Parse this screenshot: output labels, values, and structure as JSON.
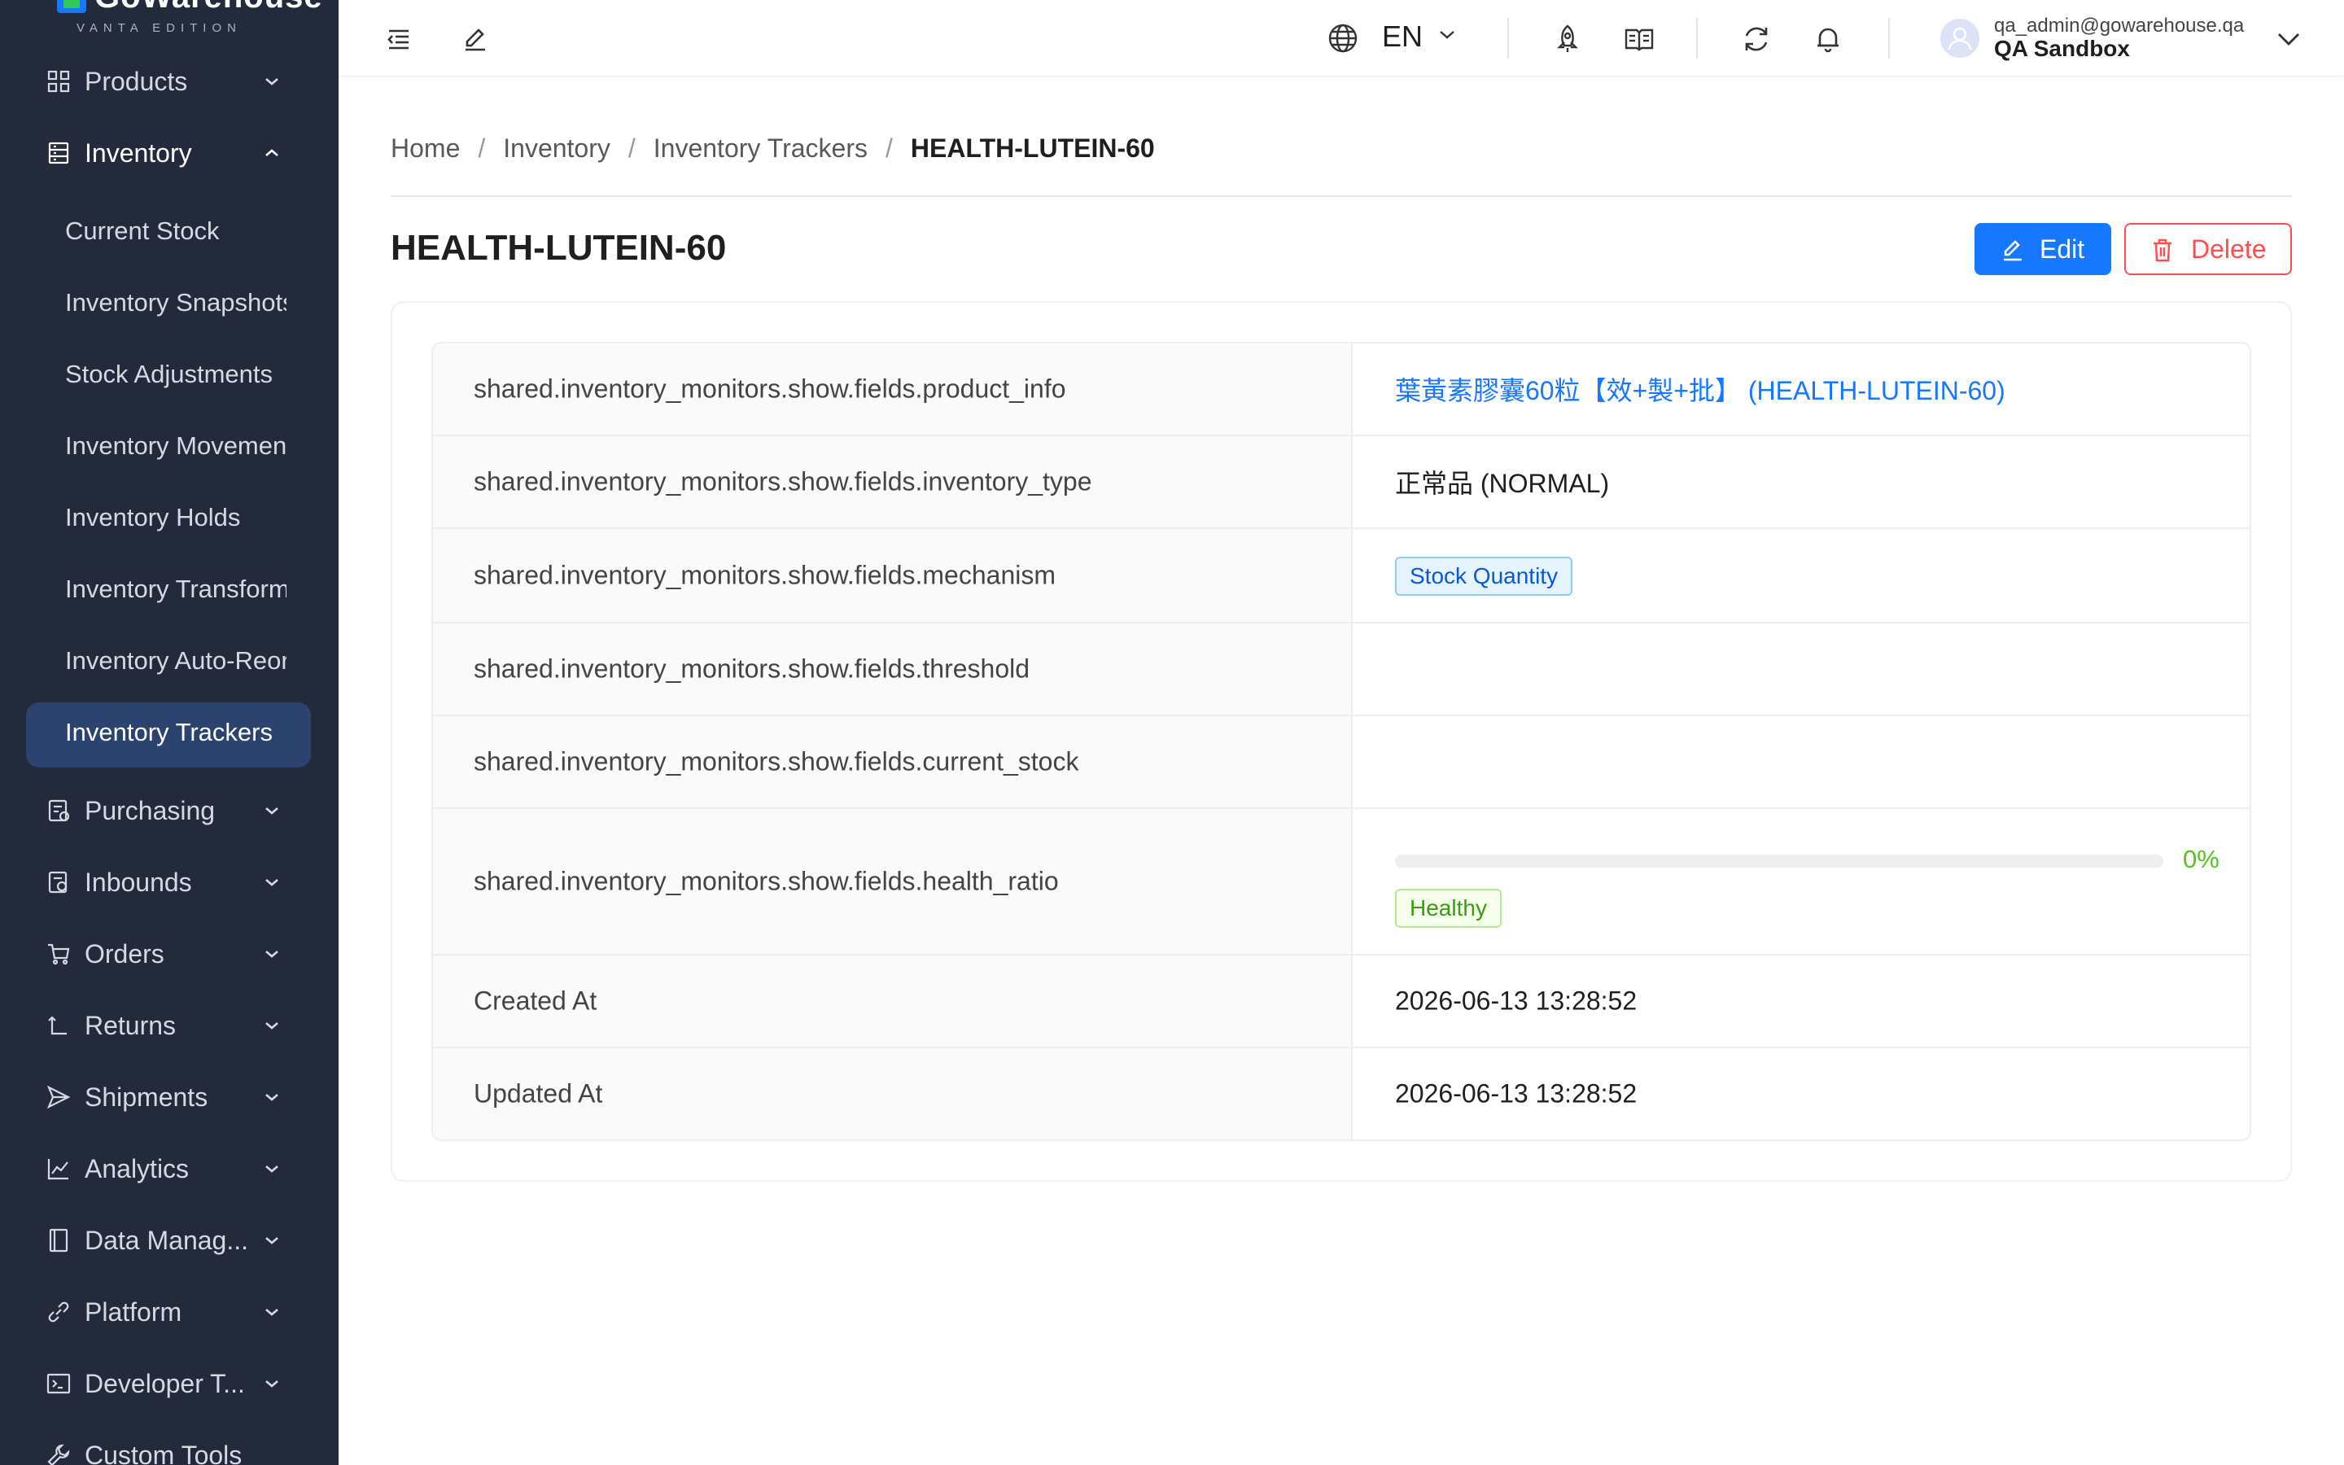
{
  "brand": {
    "name": "GoWarehouse",
    "edition": "VANTA EDITION"
  },
  "sidebar": {
    "top_items": [
      {
        "label": "Products",
        "icon": "grid-icon"
      },
      {
        "label": "Inventory",
        "icon": "inventory-icon"
      }
    ],
    "inventory_sub": [
      {
        "label": "Current Stock"
      },
      {
        "label": "Inventory Snapshots"
      },
      {
        "label": "Stock Adjustments"
      },
      {
        "label": "Inventory Movements"
      },
      {
        "label": "Inventory Holds"
      },
      {
        "label": "Inventory Transformations"
      },
      {
        "label": "Inventory Auto-Reorder"
      },
      {
        "label": "Inventory Trackers"
      }
    ],
    "items": [
      {
        "label": "Purchasing",
        "icon": "purchasing-icon"
      },
      {
        "label": "Inbounds",
        "icon": "inbounds-icon"
      },
      {
        "label": "Orders",
        "icon": "cart-icon"
      },
      {
        "label": "Returns",
        "icon": "return-icon"
      },
      {
        "label": "Shipments",
        "icon": "send-icon"
      },
      {
        "label": "Analytics",
        "icon": "chart-icon"
      },
      {
        "label": "Data Manag...",
        "icon": "book-icon"
      },
      {
        "label": "Platform",
        "icon": "link-icon"
      },
      {
        "label": "Developer T...",
        "icon": "terminal-icon"
      },
      {
        "label": "Custom Tools",
        "icon": "tool-icon"
      }
    ]
  },
  "header": {
    "language": "EN",
    "user_email": "qa_admin@gowarehouse.qa",
    "org": "QA Sandbox"
  },
  "breadcrumb": [
    "Home",
    "Inventory",
    "Inventory Trackers",
    "HEALTH-LUTEIN-60"
  ],
  "page": {
    "title": "HEALTH-LUTEIN-60",
    "edit_label": "Edit",
    "delete_label": "Delete"
  },
  "details": {
    "product_info": {
      "label": "shared.inventory_monitors.show.fields.product_info",
      "value": "葉黃素膠囊60粒【效+製+批】 (HEALTH-LUTEIN-60)"
    },
    "inventory_type": {
      "label": "shared.inventory_monitors.show.fields.inventory_type",
      "value": "正常品 (NORMAL)"
    },
    "mechanism": {
      "label": "shared.inventory_monitors.show.fields.mechanism",
      "value": "Stock Quantity"
    },
    "threshold": {
      "label": "shared.inventory_monitors.show.fields.threshold",
      "value": ""
    },
    "current_stock": {
      "label": "shared.inventory_monitors.show.fields.current_stock",
      "value": ""
    },
    "health_ratio": {
      "label": "shared.inventory_monitors.show.fields.health_ratio",
      "percent": 0,
      "percent_text": "0%",
      "status": "Healthy"
    },
    "created_at": {
      "label": "Created At",
      "value": "2026-06-13 13:28:52"
    },
    "updated_at": {
      "label": "Updated At",
      "value": "2026-06-13 13:28:52"
    }
  },
  "colors": {
    "primary": "#1677ff",
    "danger": "#ff4d4f",
    "success": "#52c41a",
    "sidebar": "#232a3b",
    "active": "#2c4370"
  }
}
